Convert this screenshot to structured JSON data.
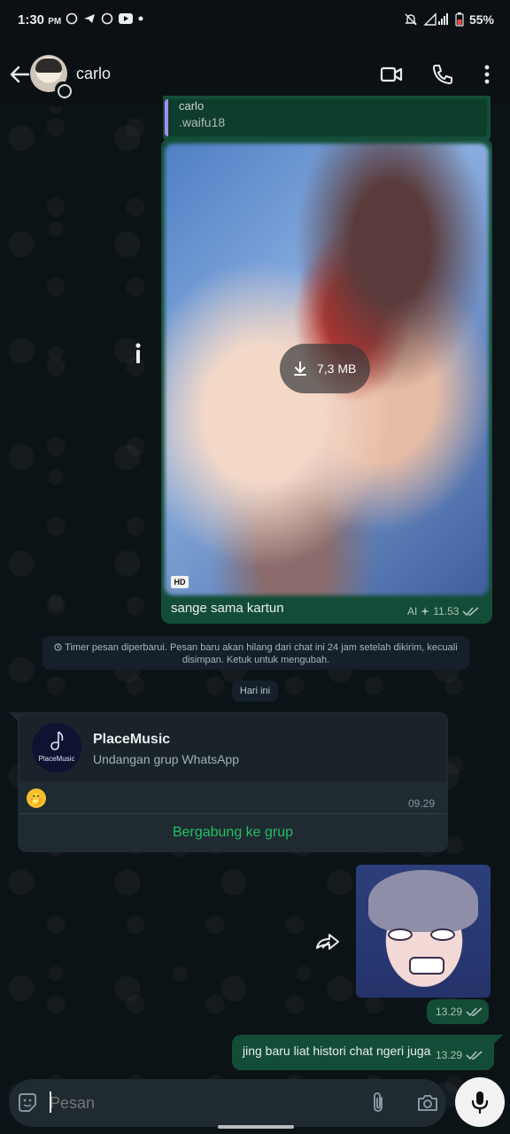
{
  "status_bar": {
    "time": "1:30",
    "ampm": "PM",
    "battery": "55%"
  },
  "header": {
    "contact_name": "carlo"
  },
  "messages": {
    "quoted": {
      "name": "carlo",
      "text": ".waifu18"
    },
    "media": {
      "download_size": "7,3 MB",
      "hd_badge": "HD",
      "caption": "sange sama kartun",
      "ai_label": "AI",
      "time": "11.53"
    },
    "notice": "Timer pesan diperbarui. Pesan baru akan hilang dari chat ini 24 jam setelah dikirim, kecuali disimpan. Ketuk untuk mengubah.",
    "day_separator": "Hari ini",
    "invite": {
      "group_name": "PlaceMusic",
      "logo_text": "PlaceMusic",
      "subtitle": "Undangan grup WhatsApp",
      "emoji": "🤭",
      "time": "09.29",
      "join_label": "Bergabung ke grup"
    },
    "sticker": {
      "time": "13.29"
    },
    "outgoing": {
      "text": "jing baru liat histori chat ngeri juga",
      "time": "13.29"
    }
  },
  "input": {
    "placeholder": "Pesan"
  },
  "colors": {
    "accent_green": "#21c063",
    "outgoing_bubble": "#144d37",
    "incoming_bubble": "#1f2a31",
    "background": "#0b1014"
  }
}
